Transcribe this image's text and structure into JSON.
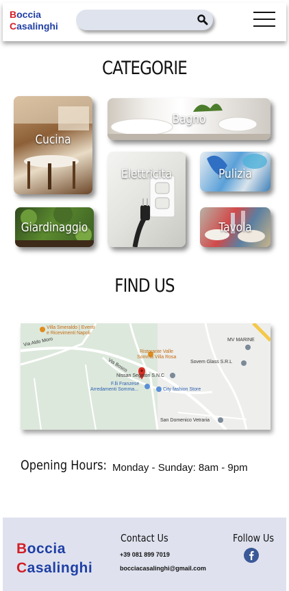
{
  "header": {
    "brand_line1_initial": "B",
    "brand_line1_rest": "occia",
    "brand_line2_initial": "C",
    "brand_line2_rest": "asalinghi",
    "search_placeholder": "",
    "search_icon": "search-icon",
    "menu_icon": "hamburger-menu-icon"
  },
  "categories": {
    "title": "CATEGORIE",
    "items": [
      {
        "label": "Cucina"
      },
      {
        "label": "Bagno"
      },
      {
        "label": "Elettricita"
      },
      {
        "label": "Pulizia"
      },
      {
        "label": "Giardinaggio"
      },
      {
        "label": "Tavola"
      }
    ]
  },
  "find_us": {
    "title": "FIND US",
    "map_labels": {
      "villa_smeraldo_1": "Villa Smeraldo | Eventi",
      "villa_smeraldo_2": "e Ricevimenti Napoli",
      "via_aldo_moro": "Via Aldo Moro",
      "ristorante_1": "Ristorante Valle",
      "ristorante_2": "Somma Villa Rosa",
      "mv_marine": "MV MARINE",
      "sovem": "Sovem Glass S.R.L",
      "via_bosco": "Via Bosco",
      "nissan": "Nissan Segatori S.N.C",
      "franzese_1": "F.lli Franzese",
      "franzese_2": "Arredamenti Somma...",
      "city_fashion": "City fashion Store",
      "san_domenico": "San Domenico Vetraria"
    }
  },
  "hours": {
    "label": "Opening Hours:",
    "value": "Monday - Sunday:  8am - 9pm"
  },
  "footer": {
    "brand_line1_initial": "B",
    "brand_line1_rest": "occia",
    "brand_line2_initial": "C",
    "brand_line2_rest": "asalinghi",
    "contact_title": "Contact Us",
    "phone": "+39 081 899 7019",
    "email": "bocciacasalinghi@gmail.com",
    "follow_title": "Follow Us",
    "facebook_icon": "facebook-icon"
  },
  "colors": {
    "brand_blue": "#1f3fa6",
    "brand_red": "#d21f26",
    "footer_bg": "#dfe2ee",
    "search_bg": "#dfe3ee",
    "facebook_blue": "#3b5998"
  }
}
